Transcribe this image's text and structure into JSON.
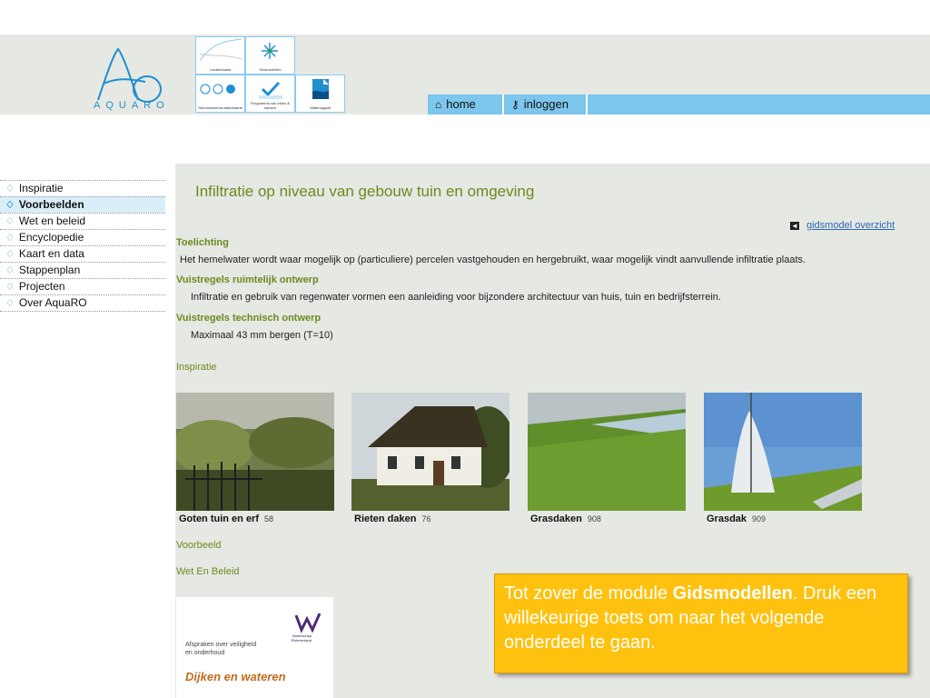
{
  "logo": {
    "text": "AQUARO",
    "icon": "aquaro-logo-icon"
  },
  "tiles": [
    {
      "label": "Locatiekaarts",
      "icon": "map-sketch-icon"
    },
    {
      "label": "Gidsmodellen",
      "icon": "compass-star-icon"
    },
    {
      "label": "Stroomschema waterkaarts",
      "icon": "steps-icon"
    },
    {
      "label": "Programma van eisen & kansen",
      "icon": "checkmark-icon"
    },
    {
      "label": "Wateropgaaf",
      "icon": "water-document-icon"
    }
  ],
  "nav": {
    "home": "home",
    "login": "inloggen"
  },
  "sidebar": {
    "items": [
      {
        "label": "Inspiratie"
      },
      {
        "label": "Voorbeelden"
      },
      {
        "label": "Wet en beleid"
      },
      {
        "label": "Encyclopedie"
      },
      {
        "label": "Kaart en data"
      },
      {
        "label": "Stappenplan"
      },
      {
        "label": "Projecten"
      },
      {
        "label": "Over AquaRO"
      }
    ]
  },
  "main": {
    "title": "Infiltratie op niveau van gebouw tuin en omgeving",
    "overview_link": "gidsmodel overzicht",
    "sections": [
      {
        "heading": "Toelichting",
        "text": "Het hemelwater wordt waar mogelijk op (particuliere) percelen vastgehouden en hergebruikt, waar mogelijk vindt aanvullende infiltratie plaats."
      },
      {
        "heading": "Vuistregels ruimtelijk ontwerp",
        "text": "Infiltratie en gebruik van regenwater vormen een aanleiding voor bijzondere architectuur van huis, tuin en bedrijfsterrein."
      },
      {
        "heading": "Vuistregels technisch ontwerp",
        "text": "Maximaal 43 mm bergen (T=10)"
      }
    ],
    "inspiratie_label": "Inspiratie",
    "cards": [
      {
        "title": "Goten tuin en erf",
        "num": "58"
      },
      {
        "title": "Rieten daken",
        "num": "76"
      },
      {
        "title": "Grasdaken",
        "num": "908"
      },
      {
        "title": "Grasdak",
        "num": "909"
      }
    ],
    "voorbeeld_label": "Voorbeeld",
    "wet_label": "Wet En Beleid",
    "leaflet": {
      "line1": "Afspraken over veiligheid en onderhoud",
      "title": "Dijken en wateren",
      "org": "Waterschap Rivierenland"
    }
  },
  "callout": {
    "prefix": "Tot zover de module ",
    "bold": "Gidsmodellen",
    "suffix": ". Druk een willekeurige toets om naar het volgende onderdeel te gaan."
  },
  "colors": {
    "accent_green": "#6b8a1e",
    "nav_blue": "#7dc6ed",
    "callout_yellow": "#fec10e",
    "panel_gray": "#e6e8e3"
  }
}
